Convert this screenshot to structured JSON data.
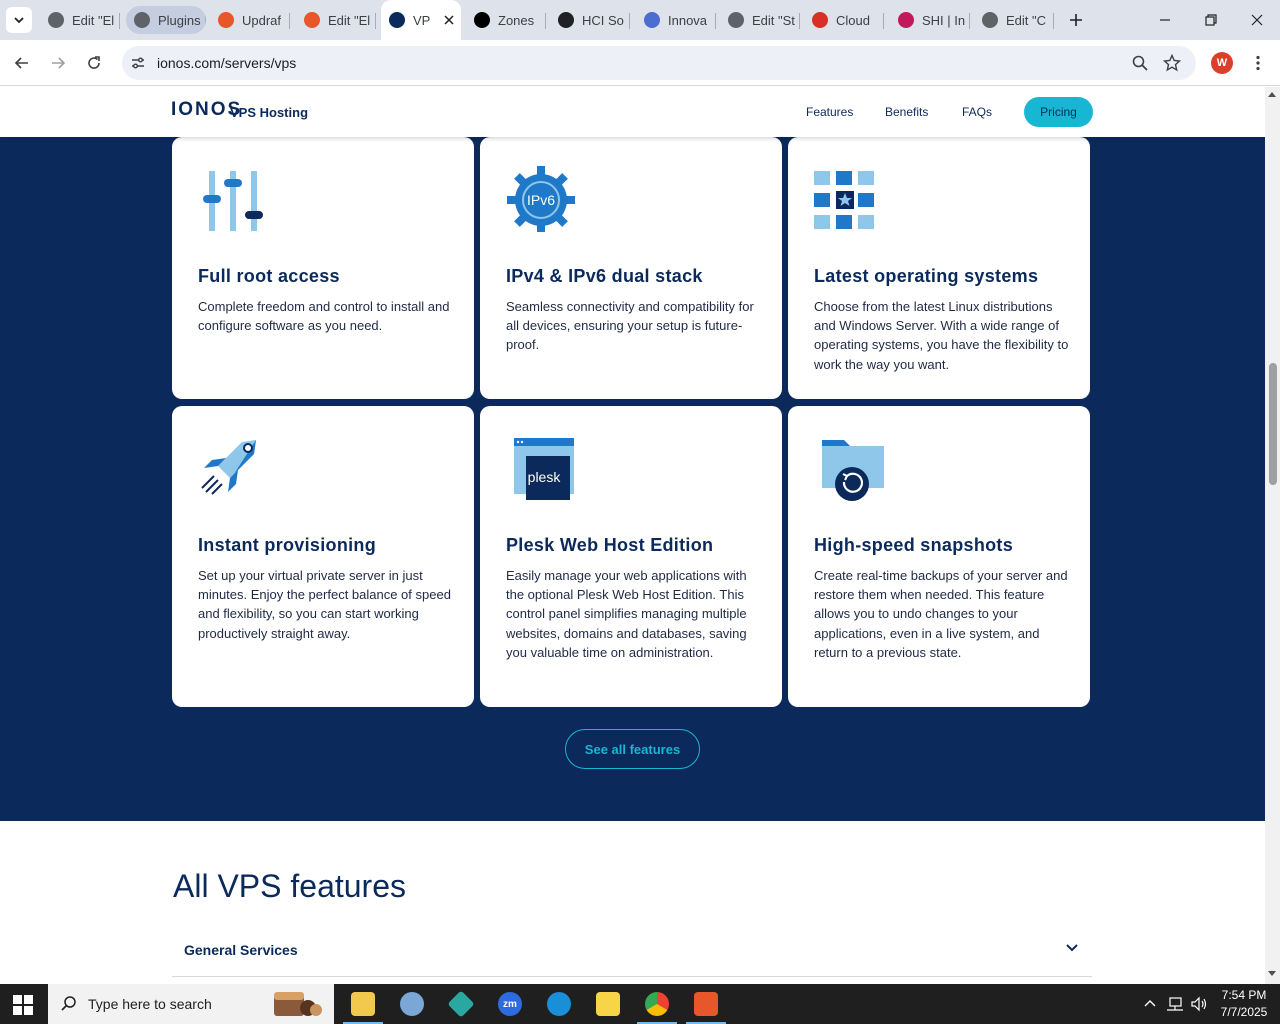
{
  "browser": {
    "tabs": [
      {
        "label": "Edit \"El",
        "color": "#5f6368",
        "state": "normal"
      },
      {
        "label": "Plugins",
        "color": "#5f6368",
        "state": "highlighted"
      },
      {
        "label": "Updraf",
        "color": "#e8562b",
        "state": "normal"
      },
      {
        "label": "Edit \"El",
        "color": "#e8562b",
        "state": "normal"
      },
      {
        "label": "VP",
        "color": "#0b2a5b",
        "state": "active"
      },
      {
        "label": "Zones",
        "color": "#000000",
        "state": "normal"
      },
      {
        "label": "HCI So",
        "color": "#202124",
        "state": "normal"
      },
      {
        "label": "Innova",
        "color": "#4a6fd1",
        "state": "normal"
      },
      {
        "label": "Edit \"St",
        "color": "#5f6368",
        "state": "normal"
      },
      {
        "label": "Cloud",
        "color": "#d93025",
        "state": "normal"
      },
      {
        "label": "SHI | In",
        "color": "#c2185b",
        "state": "normal"
      },
      {
        "label": "Edit \"C",
        "color": "#5f6368",
        "state": "normal"
      }
    ],
    "url": "ionos.com/servers/vps",
    "profile_initial": "W"
  },
  "site": {
    "logo": "IONOS",
    "logo_sub": "VPS Hosting",
    "nav": {
      "features": "Features",
      "benefits": "Benefits",
      "faqs": "FAQs",
      "pricing": "Pricing"
    }
  },
  "features": [
    {
      "title": "Full root access",
      "desc": "Complete freedom and control to install and configure software as you need.",
      "icon": "sliders-icon"
    },
    {
      "title": "IPv4 & IPv6 dual stack",
      "desc": "Seamless connectivity and compatibility for all devices, ensuring your setup is future-proof.",
      "icon": "ipv6-gear-icon",
      "icon_text": "IPv6"
    },
    {
      "title": "Latest operating systems",
      "desc": "Choose from the latest Linux distributions and Windows Server. With a wide range of operating systems, you have the flexibility to work the way you want.",
      "icon": "os-grid-icon"
    },
    {
      "title": "Instant provisioning",
      "desc": "Set up your virtual private server in just minutes. Enjoy the perfect balance of speed and flexibility, so you can start working productively straight away.",
      "icon": "rocket-icon"
    },
    {
      "title": "Plesk Web Host Edition",
      "desc": "Easily manage your web applications with the optional Plesk Web Host Edition. This control panel simplifies managing multiple websites, domains and databases, saving you valuable time on administration.",
      "icon": "plesk-icon",
      "icon_text": "plesk"
    },
    {
      "title": "High-speed snapshots",
      "desc": "Create real-time backups of your server and restore them when needed. This feature allows you to undo changes to your applications, even in a live system, and return to a previous state.",
      "icon": "snapshot-folder-icon"
    }
  ],
  "see_all": "See all features",
  "all_features": {
    "title": "All VPS features",
    "first_group": "General Services"
  },
  "taskbar": {
    "search_placeholder": "Type here to search",
    "time": "7:54 PM",
    "date": "7/7/2025"
  },
  "colors": {
    "brand_dark": "#0b2a5b",
    "accent": "#17b6d3",
    "icon_light": "#8ec7ea",
    "icon_mid": "#1f78c8"
  }
}
